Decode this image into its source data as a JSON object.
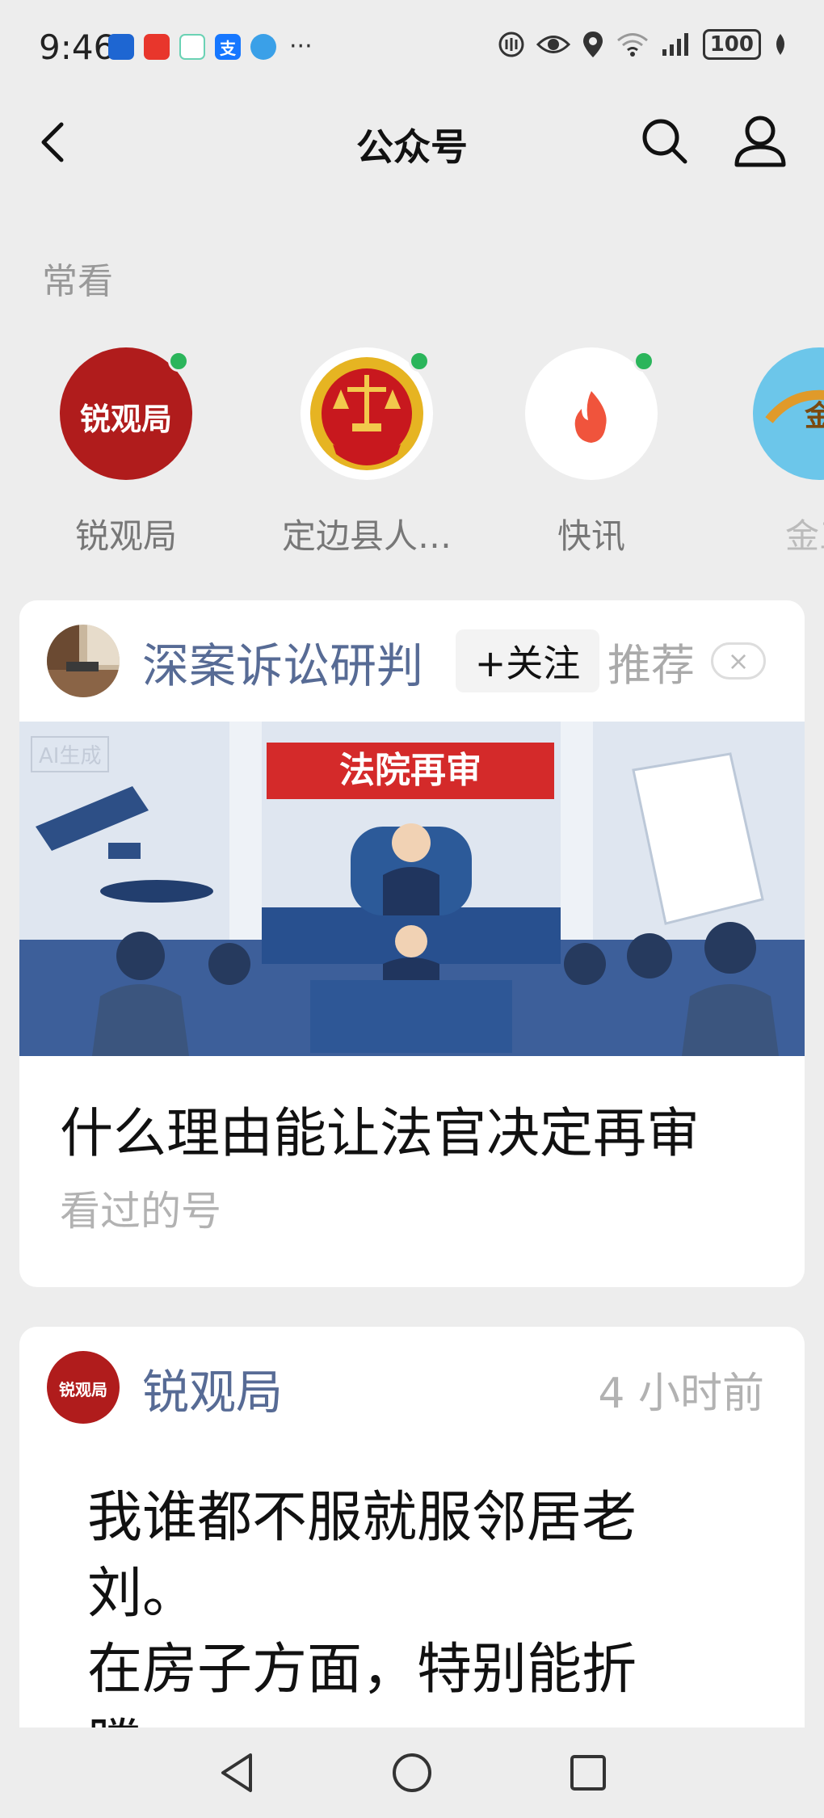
{
  "status_bar": {
    "time": "9:46",
    "battery": "100",
    "notification_apps": [
      "app-icon-1",
      "app-icon-2",
      "app-icon-3",
      "alipay-icon",
      "app-icon-5"
    ],
    "alipay_glyph": "支",
    "more_glyph": "···"
  },
  "nav": {
    "title": "公众号"
  },
  "frequent": {
    "label": "常看",
    "items": [
      {
        "name": "锐观局",
        "avatar_text": "锐观局",
        "avatar_color": "#b01c1c",
        "unread": true
      },
      {
        "name": "定边县人…",
        "avatar_color": "#c8181e",
        "unread": true
      },
      {
        "name": "快讯",
        "avatar_color": "#ffffff",
        "unread": true
      },
      {
        "name": "金三",
        "avatar_text": "金",
        "avatar_color": "#6cc6ea",
        "unread": false
      }
    ]
  },
  "recommended_card": {
    "account_name": "深案诉讼研判",
    "follow_label": "+关注",
    "recommend_label": "推荐",
    "close_glyph": "×",
    "cover_banner": "法院再审",
    "cover_watermark": "AI生成",
    "title": "什么理由能让法官决定再审",
    "subtitle": "看过的号"
  },
  "post_card": {
    "account_name": "锐观局",
    "avatar_text": "锐观局",
    "time_ago": "4 小时前",
    "text": "我谁都不服就服邻居老\n刘。\n在房子方面，特别能折\n腾"
  },
  "colors": {
    "background": "#ededed",
    "link_blue": "#576b95",
    "online_green": "#2bb55b",
    "muted_gray": "#b2b2b2"
  }
}
